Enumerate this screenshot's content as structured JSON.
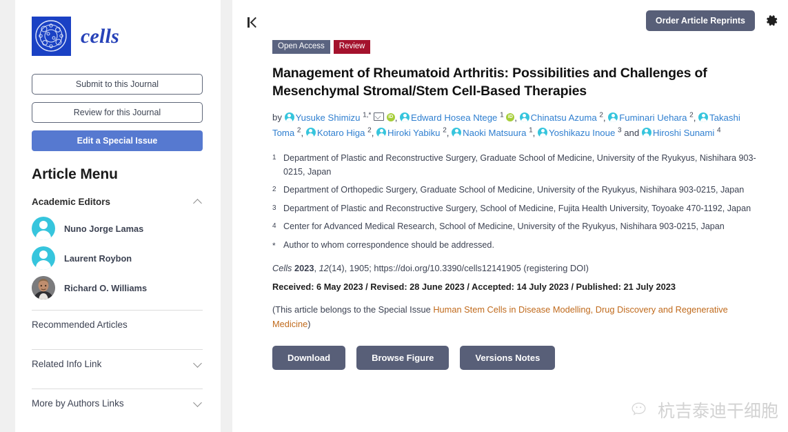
{
  "sidebar": {
    "logo": {
      "word": "cells",
      "icon": "cells-sphere-logo"
    },
    "buttons": {
      "submit": "Submit to this Journal",
      "review": "Review for this Journal",
      "special_issue": "Edit a Special Issue"
    },
    "menu_title": "Article Menu",
    "academic_editors": {
      "label": "Academic Editors",
      "expanded": true,
      "editors": [
        {
          "name": "Nuno Jorge Lamas",
          "avatar": "generic-person-avatar"
        },
        {
          "name": "Laurent Roybon",
          "avatar": "generic-person-avatar"
        },
        {
          "name": "Richard O. Williams",
          "avatar": "photo-avatar"
        }
      ]
    },
    "links": [
      {
        "label": "Recommended Articles",
        "chevron": false
      },
      {
        "label": "Related Info Link",
        "chevron": true
      },
      {
        "label": "More by Authors Links",
        "chevron": true
      }
    ]
  },
  "main": {
    "collapse_icon": "collapse-to-start-icon",
    "order_reprints": "Order Article Reprints",
    "gear_icon": "gear-icon",
    "badges": [
      {
        "label": "Open Access",
        "color": "#5a6380"
      },
      {
        "label": "Review",
        "color": "#a4122d"
      }
    ],
    "title": "Management of Rheumatoid Arthritis: Possibilities and Challenges of Mesenchymal Stromal/Stem Cell-Based Therapies",
    "by_label": "by",
    "authors": [
      {
        "name": "Yusuke Shimizu",
        "sup": "1,*",
        "orcid": true,
        "mail": true,
        "sep": ","
      },
      {
        "name": "Edward Hosea Ntege",
        "sup": "1",
        "orcid": true,
        "mail": false,
        "sep": ","
      },
      {
        "name": "Chinatsu Azuma",
        "sup": "2",
        "orcid": false,
        "mail": false,
        "sep": ","
      },
      {
        "name": "Fuminari Uehara",
        "sup": "2",
        "orcid": false,
        "mail": false,
        "sep": ","
      },
      {
        "name": "Takashi Toma",
        "sup": "2",
        "orcid": false,
        "mail": false,
        "sep": ","
      },
      {
        "name": "Kotaro Higa",
        "sup": "2",
        "orcid": false,
        "mail": false,
        "sep": ","
      },
      {
        "name": "Hiroki Yabiku",
        "sup": "2",
        "orcid": false,
        "mail": false,
        "sep": ","
      },
      {
        "name": "Naoki Matsuura",
        "sup": "1",
        "orcid": false,
        "mail": false,
        "sep": ","
      },
      {
        "name": "Yoshikazu Inoue",
        "sup": "3",
        "orcid": false,
        "mail": false,
        "sep": " and"
      },
      {
        "name": "Hiroshi Sunami",
        "sup": "4",
        "orcid": false,
        "mail": false,
        "sep": ""
      }
    ],
    "affiliations": [
      {
        "mark": "1",
        "text": "Department of Plastic and Reconstructive Surgery, Graduate School of Medicine, University of the Ryukyus, Nishihara 903-0215, Japan"
      },
      {
        "mark": "2",
        "text": "Department of Orthopedic Surgery, Graduate School of Medicine, University of the Ryukyus, Nishihara 903-0215, Japan"
      },
      {
        "mark": "3",
        "text": "Department of Plastic and Reconstructive Surgery, School of Medicine, Fujita Health University, Toyoake 470-1192, Japan"
      },
      {
        "mark": "4",
        "text": "Center for Advanced Medical Research, School of Medicine, University of the Ryukyus, Nishihara 903-0215, Japan"
      },
      {
        "mark": "*",
        "text": "Author to whom correspondence should be addressed."
      }
    ],
    "citation": {
      "journal": "Cells",
      "year": "2023",
      "volume": "12",
      "issue": "(14)",
      "article": "1905",
      "doi": "https://doi.org/10.3390/cells12141905",
      "doi_note": "(registering DOI)",
      "full": "Cells 2023, 12(14), 1905; https://doi.org/10.3390/cells12141905 (registering DOI)"
    },
    "dates": "Received: 6 May 2023 / Revised: 28 June 2023 / Accepted: 14 July 2023 / Published: 21 July 2023",
    "special_issue": {
      "prefix": "(This article belongs to the Special Issue ",
      "link": "Human Stem Cells in Disease Modelling, Drug Discovery and Regenerative Medicine",
      "suffix": ")"
    },
    "actions": [
      {
        "label": "Download"
      },
      {
        "label": "Browse Figure"
      },
      {
        "label": "Versions Notes"
      }
    ]
  },
  "watermark": {
    "text": "杭吉泰迪干细胞",
    "icon": "wechat-icon"
  }
}
